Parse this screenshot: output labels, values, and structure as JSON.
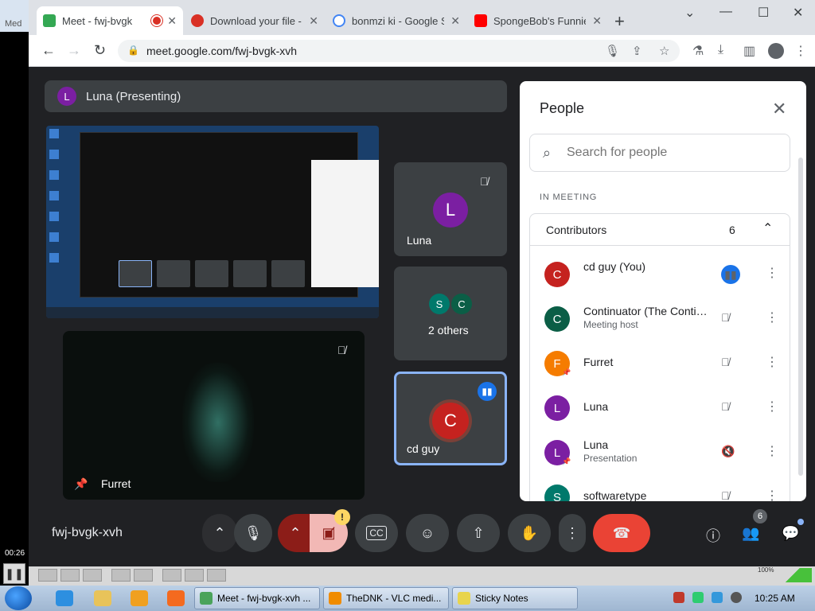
{
  "vlc": {
    "top_label": "Med",
    "time": "00:26",
    "pause_icon": "pause-icon",
    "volume": "100%"
  },
  "browser": {
    "tabs": [
      {
        "title": "Meet - fwj-bvgk",
        "icon": "meet-icon",
        "active": true,
        "recording": true
      },
      {
        "title": "Download your file -",
        "icon": "download-site-icon",
        "active": false
      },
      {
        "title": "bonmzi ki - Google S",
        "icon": "google-icon",
        "active": false
      },
      {
        "title": "SpongeBob's Funnie",
        "icon": "youtube-icon",
        "active": false
      }
    ],
    "url": "meet.google.com/fwj-bvgk-xvh"
  },
  "meet": {
    "presenting_label": "Luna (Presenting)",
    "presenting_initial": "L",
    "tiles": {
      "furret_name": "Furret",
      "luna_name": "Luna",
      "luna_initial": "L",
      "others_label": "2 others",
      "others_initials": [
        "S",
        "C"
      ],
      "cd_name": "cd guy",
      "cd_initial": "C"
    },
    "meeting_code": "fwj-bvgk-xvh",
    "warning_badge": "!",
    "people_count_badge": "6"
  },
  "people_panel": {
    "title": "People",
    "search_placeholder": "Search for people",
    "section_label": "IN MEETING",
    "group_label": "Contributors",
    "group_count": "6",
    "participants": [
      {
        "initial": "C",
        "name": "cd guy (You)",
        "sub": "",
        "color": "#c5221f",
        "status": "speaking"
      },
      {
        "initial": "C",
        "name": "Continuator (The Continuator)",
        "sub": "Meeting host",
        "color": "#0b5e46",
        "status": "muted"
      },
      {
        "initial": "F",
        "name": "Furret",
        "sub": "",
        "color": "#f57c00",
        "status": "muted",
        "pinned": true
      },
      {
        "initial": "L",
        "name": "Luna",
        "sub": "",
        "color": "#7b1fa2",
        "status": "muted"
      },
      {
        "initial": "L",
        "name": "Luna",
        "sub": "Presentation",
        "color": "#7b1fa2",
        "status": "audio-off",
        "pinned": true
      },
      {
        "initial": "S",
        "name": "softwaretype",
        "sub": "",
        "color": "#00796b",
        "status": "muted"
      }
    ]
  },
  "taskbar": {
    "tasks": [
      {
        "label": "Meet - fwj-bvgk-xvh ...",
        "color": "#4aa35a"
      },
      {
        "label": "TheDNK - VLC medi...",
        "color": "#f08c00"
      },
      {
        "label": "Sticky Notes",
        "color": "#e8d44d"
      }
    ],
    "clock": "10:25 AM"
  },
  "colors": {
    "meet_bg": "#202124",
    "tile_bg": "#3c4043",
    "accent_blue": "#1a73e8",
    "end_call_red": "#ea4335"
  }
}
